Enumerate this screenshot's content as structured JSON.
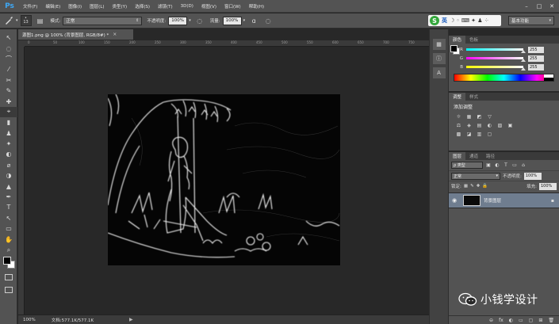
{
  "app": {
    "logo": "Ps"
  },
  "menu": [
    "文件(F)",
    "编辑(E)",
    "图像(I)",
    "图层(L)",
    "类型(Y)",
    "选择(S)",
    "滤镜(T)",
    "3D(D)",
    "视图(V)",
    "窗口(W)",
    "帮助(H)"
  ],
  "window_controls": [
    "–",
    "□",
    "✕"
  ],
  "options": {
    "brush_size": "13",
    "mode_label": "模式:",
    "mode_value": "正常",
    "opacity_label": "不透明度:",
    "opacity_value": "100%",
    "flow_label": "流量:",
    "flow_value": "100%"
  },
  "ime": {
    "logo": "S",
    "lang": "英",
    "glyphs": "☽ ◦ ⌨ ✦ ♟ ⁘"
  },
  "workspace": "基本功能",
  "document": {
    "tab_title": "源图1.png @ 100% (背景图层, RGB/8#) *",
    "close": "×",
    "ruler_ticks": [
      "0",
      "50",
      "100",
      "150",
      "200",
      "250",
      "300",
      "350",
      "400",
      "450",
      "500",
      "550",
      "600",
      "650",
      "700",
      "750"
    ],
    "zoom": "100%",
    "doc_size": "文档:577.1K/577.1K",
    "status_arrow": "▶"
  },
  "tools": [
    "↖",
    "◌",
    "⌒",
    "⁄",
    "✂",
    "✎",
    "✚",
    "⌖",
    "▮",
    "♟",
    "✦",
    "◐",
    "⌀",
    "◑",
    "▲",
    "✒",
    "T",
    "↖",
    "▭",
    "✋",
    "⌕",
    "⋯"
  ],
  "panels": {
    "color": {
      "tabs": [
        "颜色",
        "色板"
      ],
      "rows": [
        {
          "label": "R",
          "value": "255",
          "color": "#ff5a5a"
        },
        {
          "label": "G",
          "value": "255",
          "color": "#44dd44"
        },
        {
          "label": "B",
          "value": "255",
          "color": "#3aa0ff"
        }
      ]
    },
    "adjustments": {
      "tabs": [
        "调整",
        "样式"
      ],
      "title": "添加调整",
      "row1": [
        "☼",
        "▦",
        "◩",
        "▽"
      ],
      "row2": [
        "⚖",
        "◈",
        "▤",
        "◐",
        "▨",
        "▣"
      ],
      "row3": [
        "▩",
        "◪",
        "▥",
        "▢"
      ]
    },
    "layers": {
      "tabs": [
        "图层",
        "通道",
        "路径"
      ],
      "kind": "ρ 类型",
      "filters": [
        "▣",
        "◐",
        "T",
        "▭",
        "⌂"
      ],
      "blend": "正常",
      "opacity_label": "不透明度:",
      "opacity_value": "100%",
      "lock_label": "锁定:",
      "locks": [
        "▦",
        "✎",
        "✚",
        "🔒"
      ],
      "fill_label": "填充:",
      "fill_value": "100%",
      "layer_name": "背景图层",
      "footer": [
        "⊖",
        "fx",
        "◐",
        "▭",
        "▢",
        "⊞",
        "🗑"
      ]
    }
  },
  "watermark": {
    "text": "小钱学设计"
  }
}
